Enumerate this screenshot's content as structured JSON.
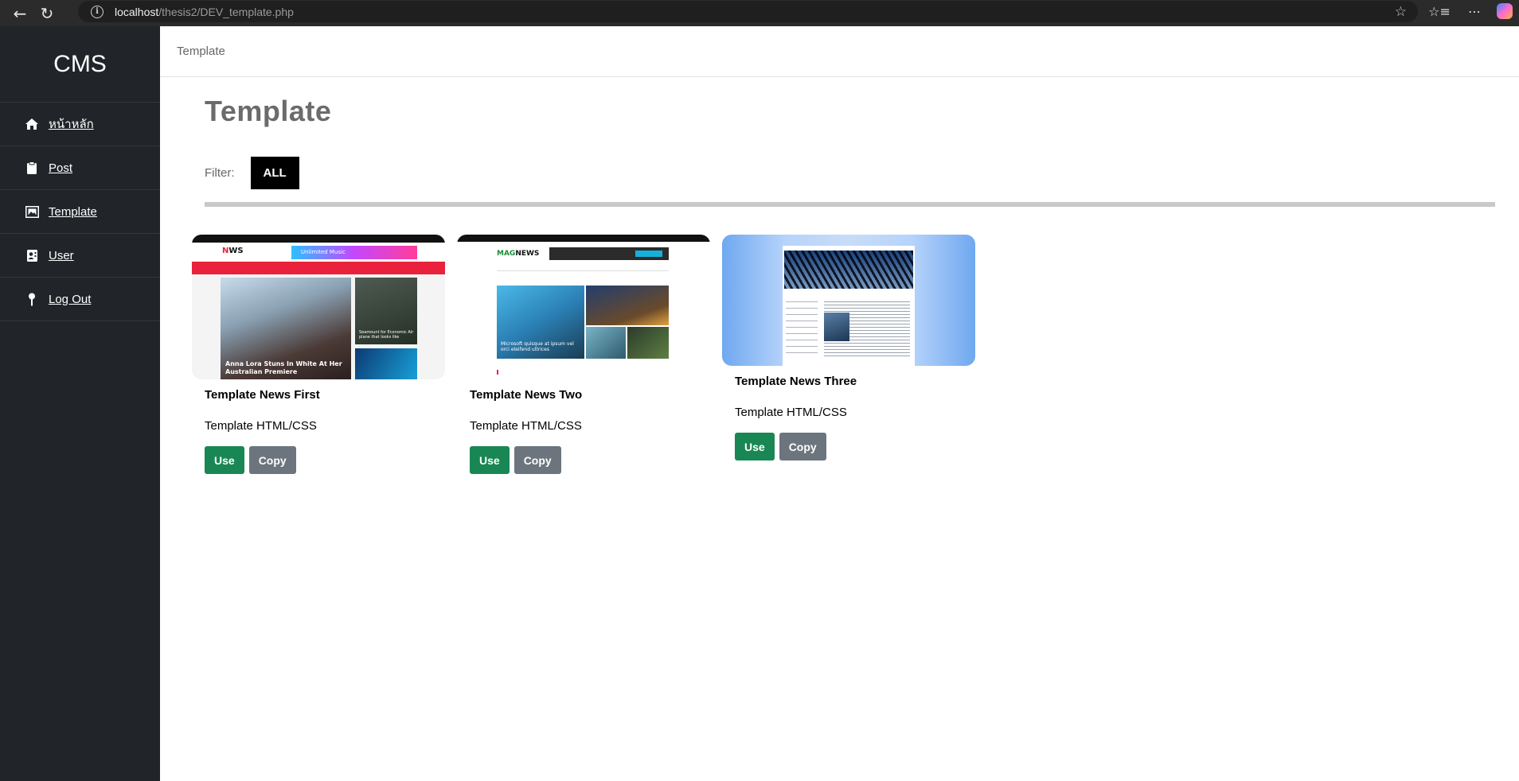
{
  "browser": {
    "url_host": "localhost",
    "url_path": "/thesis2/DEV_template.php"
  },
  "sidebar": {
    "brand": "CMS",
    "items": [
      {
        "label": "หน้าหลัก",
        "icon": "home-icon"
      },
      {
        "label": "Post",
        "icon": "clipboard-icon"
      },
      {
        "label": "Template",
        "icon": "image-frame-icon"
      },
      {
        "label": "User",
        "icon": "user-card-icon"
      },
      {
        "label": "Log Out",
        "icon": "pin-icon"
      }
    ]
  },
  "header": {
    "breadcrumb": "Template"
  },
  "main": {
    "title": "Template",
    "filter_label": "Filter:",
    "filter_all": "ALL",
    "cards": [
      {
        "title": "Template News First",
        "desc": "Template HTML/CSS",
        "use_label": "Use",
        "copy_label": "Copy",
        "thumb": {
          "logo": "N",
          "logo_rest": "WS",
          "ad_text": "Unlimited Music",
          "hero_caption": "Anna Lora Stuns In White At Her Australian Premiere",
          "side_caption": "Seamount for Economic Air plane that looks like"
        }
      },
      {
        "title": "Template News Two",
        "desc": "Template HTML/CSS",
        "use_label": "Use",
        "copy_label": "Copy",
        "thumb": {
          "logo_a": "MAG",
          "logo_b": "NEWS",
          "hero_caption": "Microsoft quisque at ipsum vel orci eleifend ultrices"
        }
      },
      {
        "title": "Template News Three",
        "desc": "Template HTML/CSS",
        "use_label": "Use",
        "copy_label": "Copy"
      }
    ]
  }
}
